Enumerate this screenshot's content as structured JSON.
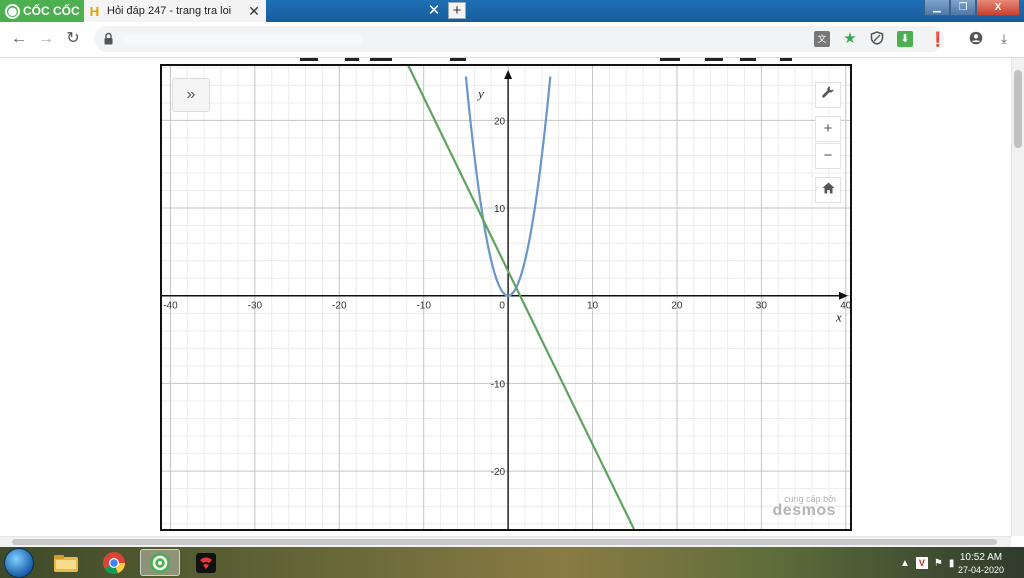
{
  "browser": {
    "brand_name": "CỐC CỐC",
    "active_tab_title": "Hỏi đáp 247 - trang tra loi",
    "tab_close_glyph": "✕",
    "new_tab_glyph": "+",
    "window_controls": {
      "minimize": "▁",
      "maximize": "❐",
      "close": "X"
    },
    "accent_color": "#4caf50",
    "titlebar_color": "#1e6fb5"
  },
  "toolbar": {
    "back_icon": "←",
    "forward_icon": "→",
    "reload_icon": "↻",
    "extension_icons": [
      "translate-icon",
      "star-icon",
      "shield-icon",
      "download-ext-icon",
      "alert-icon",
      "account-icon",
      "download-icon"
    ]
  },
  "graph": {
    "expand_glyph": "»",
    "zoom_in_glyph": "+",
    "zoom_out_glyph": "−",
    "credit_line1": "cung cấp bởi",
    "credit_line2": "desmos"
  },
  "chart_data": {
    "type": "line",
    "xlim": [
      -41,
      40.5
    ],
    "ylim": [
      -26.6,
      26.2
    ],
    "xlabel": "x",
    "ylabel": "y",
    "grid": true,
    "x_ticks": [
      "-40",
      "-30",
      "-20",
      "-10",
      "0",
      "10",
      "20",
      "30",
      "40"
    ],
    "y_ticks": [
      "20",
      "10",
      "-10",
      "-20"
    ],
    "series": [
      {
        "kind": "parabola",
        "color": "#6a96c8",
        "points": [
          [
            -5,
            25
          ],
          [
            -4,
            16
          ],
          [
            -3,
            9
          ],
          [
            -2,
            4
          ],
          [
            -1,
            1
          ],
          [
            0,
            0
          ],
          [
            1,
            1
          ],
          [
            2,
            4
          ],
          [
            3,
            9
          ],
          [
            4,
            16
          ],
          [
            5,
            25
          ]
        ]
      },
      {
        "kind": "line",
        "color": "#5fa35f",
        "points": [
          [
            -11.8,
            26.2
          ],
          [
            0,
            2.8
          ],
          [
            14.9,
            -26.6
          ]
        ]
      }
    ]
  },
  "taskbar": {
    "clock_time": "10:52 AM",
    "clock_date": "27-04-2020"
  }
}
